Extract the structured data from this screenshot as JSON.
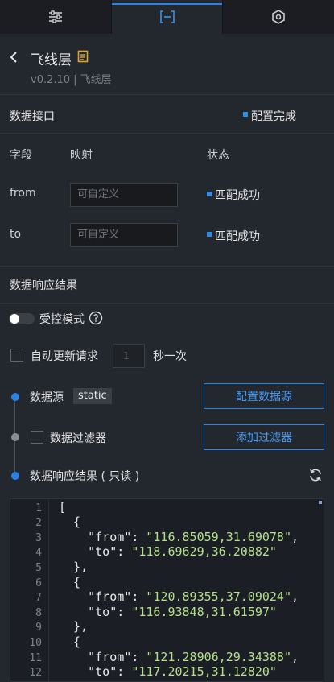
{
  "tabs": [
    {
      "name": "sliders-icon"
    },
    {
      "name": "bracket-icon"
    },
    {
      "name": "hex-settings-icon"
    }
  ],
  "header": {
    "title": "飞线层",
    "subtitle": "v0.2.10 | 飞线层"
  },
  "data_interface": {
    "title": "数据接口",
    "status": "配置完成",
    "columns": [
      "字段",
      "映射",
      "状态"
    ],
    "fields": [
      {
        "name": "from",
        "placeholder": "可自定义",
        "status": "匹配成功"
      },
      {
        "name": "to",
        "placeholder": "可自定义",
        "status": "匹配成功"
      }
    ]
  },
  "response": {
    "title": "数据响应结果",
    "controlled_label": "受控模式",
    "auto_update_label": "自动更新请求",
    "interval_value": "1",
    "per_label": "秒一次",
    "source_label": "数据源",
    "source_badge": "static",
    "config_button": "配置数据源",
    "filter_label": "数据过滤器",
    "filter_button": "添加过滤器",
    "result_label": "数据响应结果 ( 只读 )"
  },
  "code": {
    "line_numbers": [
      "1",
      "2",
      "3",
      "4",
      "5",
      "6",
      "7",
      "8",
      "9",
      "10",
      "11",
      "12"
    ],
    "lines": [
      {
        "t": "["
      },
      {
        "t": "  {"
      },
      {
        "k": "    \"from\"",
        "s": "\"116.85059,31.69078\"",
        "e": ","
      },
      {
        "k": "    \"to\"",
        "s": "\"118.69629,36.20882\"",
        "e": ""
      },
      {
        "t": "  },"
      },
      {
        "t": "  {"
      },
      {
        "k": "    \"from\"",
        "s": "\"120.89355,37.09024\"",
        "e": ","
      },
      {
        "k": "    \"to\"",
        "s": "\"116.93848,31.61597\"",
        "e": ""
      },
      {
        "t": "  },"
      },
      {
        "t": "  {"
      },
      {
        "k": "    \"from\"",
        "s": "\"121.28906,29.34388\"",
        "e": ","
      },
      {
        "k": "    \"to\"",
        "s": "\"117.20215,31.12820\"",
        "e": ""
      }
    ]
  },
  "colors": {
    "accent": "#2a82e4",
    "background": "#23272e",
    "string": "#b5e08a"
  }
}
